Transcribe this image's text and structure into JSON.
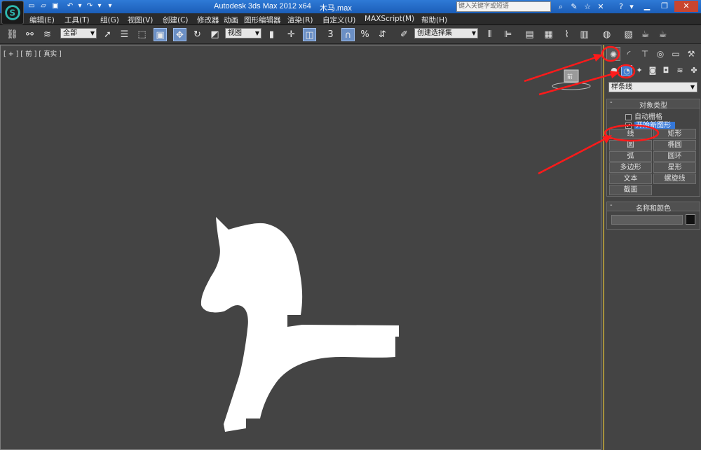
{
  "title_bar": {
    "app_title": "Autodesk 3ds Max  2012 x64",
    "file_name": "木马.max",
    "search_placeholder": "键入关键字或短语",
    "quick_access": [
      "new-icon",
      "open-icon",
      "save-icon",
      "undo-icon",
      "redo-icon",
      "dropdown-icon"
    ],
    "info_icons": [
      "binoculars-icon",
      "tools-icon",
      "star-icon",
      "help-icon"
    ],
    "window_buttons": [
      "minimize-icon",
      "restore-icon",
      "close-icon"
    ]
  },
  "menu": {
    "items": [
      "编辑(E)",
      "工具(T)",
      "组(G)",
      "视图(V)",
      "创建(C)",
      "修改器",
      "动画",
      "图形编辑器",
      "渲染(R)",
      "自定义(U)",
      "MAXScript(M)",
      "帮助(H)"
    ]
  },
  "toolbar": {
    "selection_filter": "全部",
    "reference_coord": "视图",
    "named_selection": "创建选择集",
    "snap_label": "3",
    "percent_snap": "%"
  },
  "viewport": {
    "label": "[ + ] [ 前 ] [ 真实 ]",
    "viewcube_label": "前",
    "colors": {
      "background": "#444444",
      "shape_fill": "#ffffff"
    }
  },
  "command_panel": {
    "category_dropdown": "样条线",
    "object_type": {
      "title": "对象类型",
      "autogrid_label": "自动栅格",
      "start_new_shape_label": "开始新图形",
      "start_new_shape_checked": true,
      "buttons": [
        "线",
        "矩形",
        "圆",
        "椭圆",
        "弧",
        "圆环",
        "多边形",
        "星形",
        "文本",
        "螺旋线",
        "截面"
      ]
    },
    "name_color": {
      "title": "名称和颜色",
      "name_value": "",
      "color": "#111111"
    }
  },
  "annotations": {
    "color": "#ff1a1a"
  }
}
